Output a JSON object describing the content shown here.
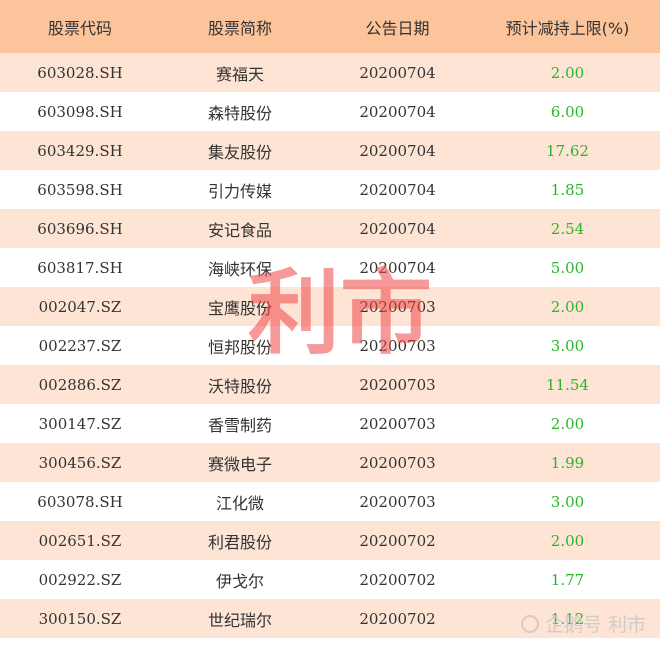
{
  "headers": [
    "股票代码",
    "股票简称",
    "公告日期",
    "预计减持上限(%)"
  ],
  "rows": [
    {
      "code": "603028.SH",
      "name": "赛福天",
      "date": "20200704",
      "limit": "2.00"
    },
    {
      "code": "603098.SH",
      "name": "森特股份",
      "date": "20200704",
      "limit": "6.00"
    },
    {
      "code": "603429.SH",
      "name": "集友股份",
      "date": "20200704",
      "limit": "17.62"
    },
    {
      "code": "603598.SH",
      "name": "引力传媒",
      "date": "20200704",
      "limit": "1.85"
    },
    {
      "code": "603696.SH",
      "name": "安记食品",
      "date": "20200704",
      "limit": "2.54"
    },
    {
      "code": "603817.SH",
      "name": "海峡环保",
      "date": "20200704",
      "limit": "5.00"
    },
    {
      "code": "002047.SZ",
      "name": "宝鹰股份",
      "date": "20200703",
      "limit": "2.00"
    },
    {
      "code": "002237.SZ",
      "name": "恒邦股份",
      "date": "20200703",
      "limit": "3.00"
    },
    {
      "code": "002886.SZ",
      "name": "沃特股份",
      "date": "20200703",
      "limit": "11.54"
    },
    {
      "code": "300147.SZ",
      "name": "香雪制药",
      "date": "20200703",
      "limit": "2.00"
    },
    {
      "code": "300456.SZ",
      "name": "赛微电子",
      "date": "20200703",
      "limit": "1.99"
    },
    {
      "code": "603078.SH",
      "name": "江化微",
      "date": "20200703",
      "limit": "3.00"
    },
    {
      "code": "002651.SZ",
      "name": "利君股份",
      "date": "20200702",
      "limit": "2.00"
    },
    {
      "code": "002922.SZ",
      "name": "伊戈尔",
      "date": "20200702",
      "limit": "1.77"
    },
    {
      "code": "300150.SZ",
      "name": "世纪瑞尔",
      "date": "20200702",
      "limit": "1.12"
    }
  ],
  "watermark": "利市",
  "brand": "企鹅号 利市",
  "colors": {
    "header_bg": "#fbc49a",
    "row_alt_bg": "#fde4d4",
    "value_green": "#2bb52b",
    "watermark_red": "#f04646"
  }
}
